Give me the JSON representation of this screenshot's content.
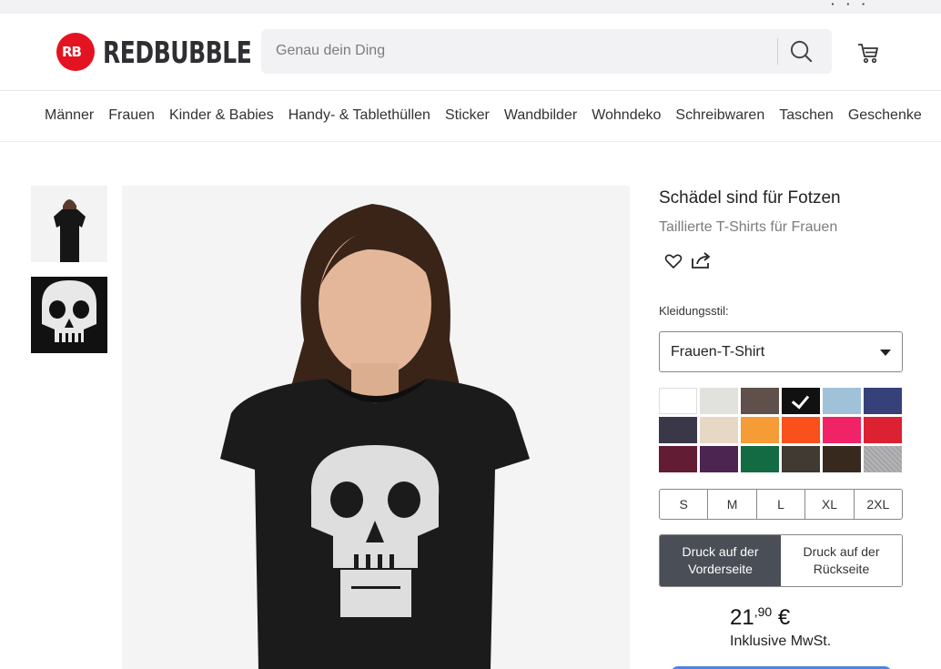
{
  "header": {
    "logo_text": "REDBUBBLE",
    "logo_mark": "RB",
    "search_placeholder": "Genau dein Ding"
  },
  "nav": {
    "items": [
      "Männer",
      "Frauen",
      "Kinder & Babies",
      "Handy- & Tablethüllen",
      "Sticker",
      "Wandbilder",
      "Wohndeko",
      "Schreibwaren",
      "Taschen",
      "Geschenke"
    ]
  },
  "product": {
    "title": "Schädel sind für Fotzen",
    "subtitle": "Taillierte T-Shirts für Frauen",
    "style_label": "Kleidungsstil:",
    "style_value": "Frauen-T-Shirt",
    "colors": [
      {
        "hex": "#ffffff",
        "selected": false
      },
      {
        "hex": "#e1e1dd",
        "selected": false
      },
      {
        "hex": "#5f504b",
        "selected": false
      },
      {
        "hex": "#111111",
        "selected": true
      },
      {
        "hex": "#9fc2d8",
        "selected": false
      },
      {
        "hex": "#36417a",
        "selected": false
      },
      {
        "hex": "#393748",
        "selected": false
      },
      {
        "hex": "#e7d8c6",
        "selected": false
      },
      {
        "hex": "#f59c36",
        "selected": false
      },
      {
        "hex": "#f9501c",
        "selected": false
      },
      {
        "hex": "#ef2366",
        "selected": false
      },
      {
        "hex": "#dc2232",
        "selected": false
      },
      {
        "hex": "#621c34",
        "selected": false
      },
      {
        "hex": "#4c2550",
        "selected": false
      },
      {
        "hex": "#126b43",
        "selected": false
      },
      {
        "hex": "#403a33",
        "selected": false
      },
      {
        "hex": "#38291f",
        "selected": false
      },
      {
        "hex": "#a4a4a6",
        "selected": false
      }
    ],
    "sizes": [
      "S",
      "M",
      "L",
      "XL",
      "2XL"
    ],
    "print_front": "Druck auf der Vorderseite",
    "print_back": "Druck auf der Rückseite",
    "price_main": "21",
    "price_cents": ",90",
    "price_currency": "€",
    "tax_note": "Inklusive MwSt."
  },
  "icons": {
    "search": "search-icon",
    "cart": "cart-icon",
    "heart": "heart-icon",
    "share": "share-icon",
    "dropdown": "caret-down-icon"
  },
  "colors": {
    "brand_red": "#e41321",
    "active_print": "#4a4e57",
    "cta_blue": "#4a86e8"
  }
}
